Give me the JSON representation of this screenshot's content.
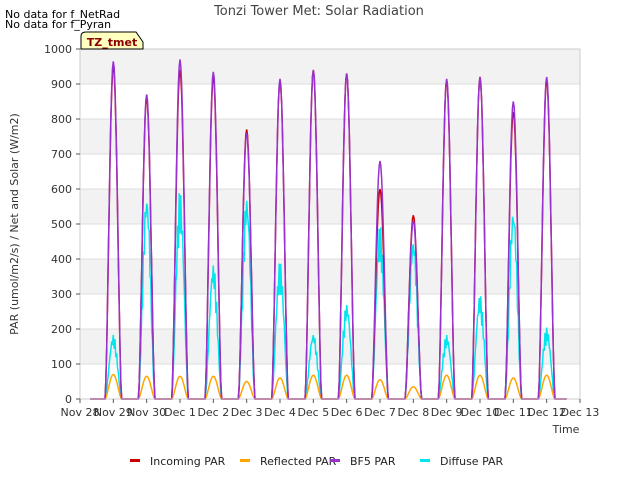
{
  "notes": [
    "No data for f_NetRad",
    "No data for f_Pyran"
  ],
  "badge": "TZ_tmet",
  "chart_data": {
    "type": "line",
    "title": "Tonzi Tower Met: Solar Radiation",
    "xlabel": "Time",
    "ylabel": "PAR (umol/m2/s) / Net and Solar (W/m2)",
    "ylim": [
      0,
      1000
    ],
    "yticks": [
      0,
      100,
      200,
      300,
      400,
      500,
      600,
      700,
      800,
      900,
      1000
    ],
    "x_ticks": [
      "Nov 28",
      "Nov 29",
      "Nov 30",
      "Dec 1",
      "Dec 2",
      "Dec 3",
      "Dec 4",
      "Dec 5",
      "Dec 6",
      "Dec 7",
      "Dec 8",
      "Dec 9",
      "Dec 10",
      "Dec 11",
      "Dec 12",
      "Dec 13"
    ],
    "legend_position": "bottom",
    "grid": true,
    "series": [
      {
        "name": "Incoming PAR",
        "color": "#cc0000",
        "daily_peaks": [
          950,
          860,
          940,
          920,
          770,
          910,
          940,
          930,
          600,
          525,
          910,
          920,
          820,
          910
        ]
      },
      {
        "name": "Reflected PAR",
        "color": "#ffa500",
        "daily_peaks": [
          70,
          65,
          65,
          65,
          50,
          60,
          68,
          68,
          55,
          35,
          68,
          68,
          60,
          68
        ]
      },
      {
        "name": "BF5 PAR",
        "color": "#9932cc",
        "daily_peaks": [
          965,
          870,
          970,
          935,
          760,
          915,
          940,
          930,
          680,
          510,
          915,
          920,
          850,
          920
        ]
      },
      {
        "name": "Diffuse PAR",
        "color": "#00e5ee",
        "daily_peaks": [
          185,
          595,
          600,
          390,
          590,
          395,
          190,
          275,
          500,
          470,
          185,
          300,
          555,
          205
        ]
      }
    ]
  }
}
